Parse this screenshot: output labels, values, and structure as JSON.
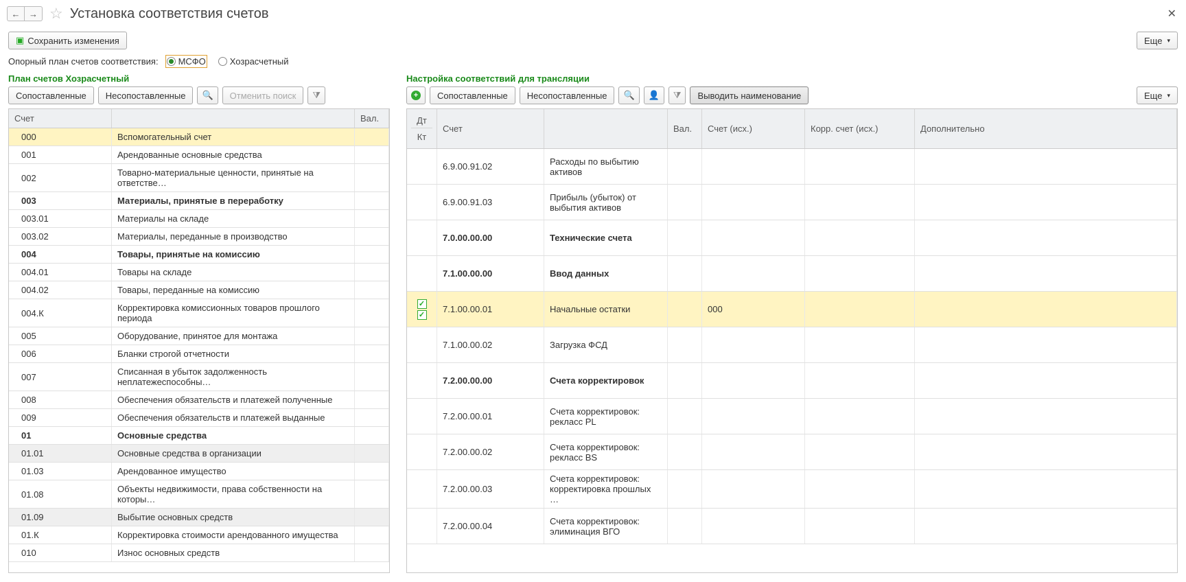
{
  "title": "Установка соответствия счетов",
  "toolbar": {
    "save": "Сохранить изменения",
    "more": "Еще"
  },
  "refplan": {
    "label": "Опорный план счетов соответствия:",
    "opt1": "МСФО",
    "opt2": "Хозрасчетный"
  },
  "left": {
    "title": "План счетов Хозрасчетный",
    "btn_matched": "Сопоставленные",
    "btn_unmatched": "Несопоставленные",
    "btn_cancel_search": "Отменить поиск",
    "col_account": "Счет",
    "col_val": "Вал.",
    "rows": [
      {
        "code": "000",
        "name": "Вспомогательный счет",
        "sel": true
      },
      {
        "code": "001",
        "name": "Арендованные основные средства"
      },
      {
        "code": "002",
        "name": "Товарно-материальные ценности, принятые на ответстве…"
      },
      {
        "code": "003",
        "name": "Материалы, принятые в переработку",
        "bold": true
      },
      {
        "code": "003.01",
        "name": "Материалы на складе"
      },
      {
        "code": "003.02",
        "name": "Материалы, переданные в производство"
      },
      {
        "code": "004",
        "name": "Товары, принятые на комиссию",
        "bold": true
      },
      {
        "code": "004.01",
        "name": "Товары на складе"
      },
      {
        "code": "004.02",
        "name": "Товары, переданные на комиссию"
      },
      {
        "code": "004.К",
        "name": "Корректировка комиссионных товаров прошлого периода"
      },
      {
        "code": "005",
        "name": "Оборудование, принятое для монтажа"
      },
      {
        "code": "006",
        "name": "Бланки строгой отчетности"
      },
      {
        "code": "007",
        "name": "Списанная в убыток задолженность неплатежеспособны…"
      },
      {
        "code": "008",
        "name": "Обеспечения обязательств и платежей полученные"
      },
      {
        "code": "009",
        "name": "Обеспечения обязательств и платежей выданные"
      },
      {
        "code": "01",
        "name": "Основные средства",
        "bold": true
      },
      {
        "code": "01.01",
        "name": "Основные средства в организации",
        "gray": true
      },
      {
        "code": "01.03",
        "name": "Арендованное имущество"
      },
      {
        "code": "01.08",
        "name": "Объекты недвижимости, права собственности на которы…"
      },
      {
        "code": "01.09",
        "name": "Выбытие основных средств",
        "gray": true
      },
      {
        "code": "01.К",
        "name": "Корректировка стоимости арендованного имущества"
      },
      {
        "code": "010",
        "name": "Износ основных средств"
      }
    ]
  },
  "right": {
    "title": "Настройка соответствий для трансляции",
    "btn_matched": "Сопоставленные",
    "btn_unmatched": "Несопоставленные",
    "btn_shownames": "Выводить наименование",
    "more": "Еще",
    "col_dt": "Дт",
    "col_kt": "Кт",
    "col_account": "Счет",
    "col_val": "Вал.",
    "col_src": "Счет (исх.)",
    "col_corr": "Корр. счет (исх.)",
    "col_extra": "Дополнительно",
    "rows": [
      {
        "acct": "6.9.00.91.02",
        "desc": "Расходы по выбытию активов"
      },
      {
        "acct": "6.9.00.91.03",
        "desc": "Прибыль (убыток) от выбытия активов"
      },
      {
        "acct": "7.0.00.00.00",
        "desc": "Технические счета",
        "bold": true
      },
      {
        "acct": "7.1.00.00.00",
        "desc": "Ввод данных",
        "bold": true
      },
      {
        "acct": "7.1.00.00.01",
        "desc": "Начальные остатки",
        "src": "000",
        "sel": true,
        "check": true
      },
      {
        "acct": "7.1.00.00.02",
        "desc": "Загрузка ФСД"
      },
      {
        "acct": "7.2.00.00.00",
        "desc": "Счета корректировок",
        "bold": true
      },
      {
        "acct": "7.2.00.00.01",
        "desc": "Счета корректировок: рекласс PL"
      },
      {
        "acct": "7.2.00.00.02",
        "desc": "Счета корректировок: рекласс BS"
      },
      {
        "acct": "7.2.00.00.03",
        "desc": "Счета корректировок: корректировка прошлых …"
      },
      {
        "acct": "7.2.00.00.04",
        "desc": "Счета корректировок: элиминация ВГО"
      }
    ]
  }
}
